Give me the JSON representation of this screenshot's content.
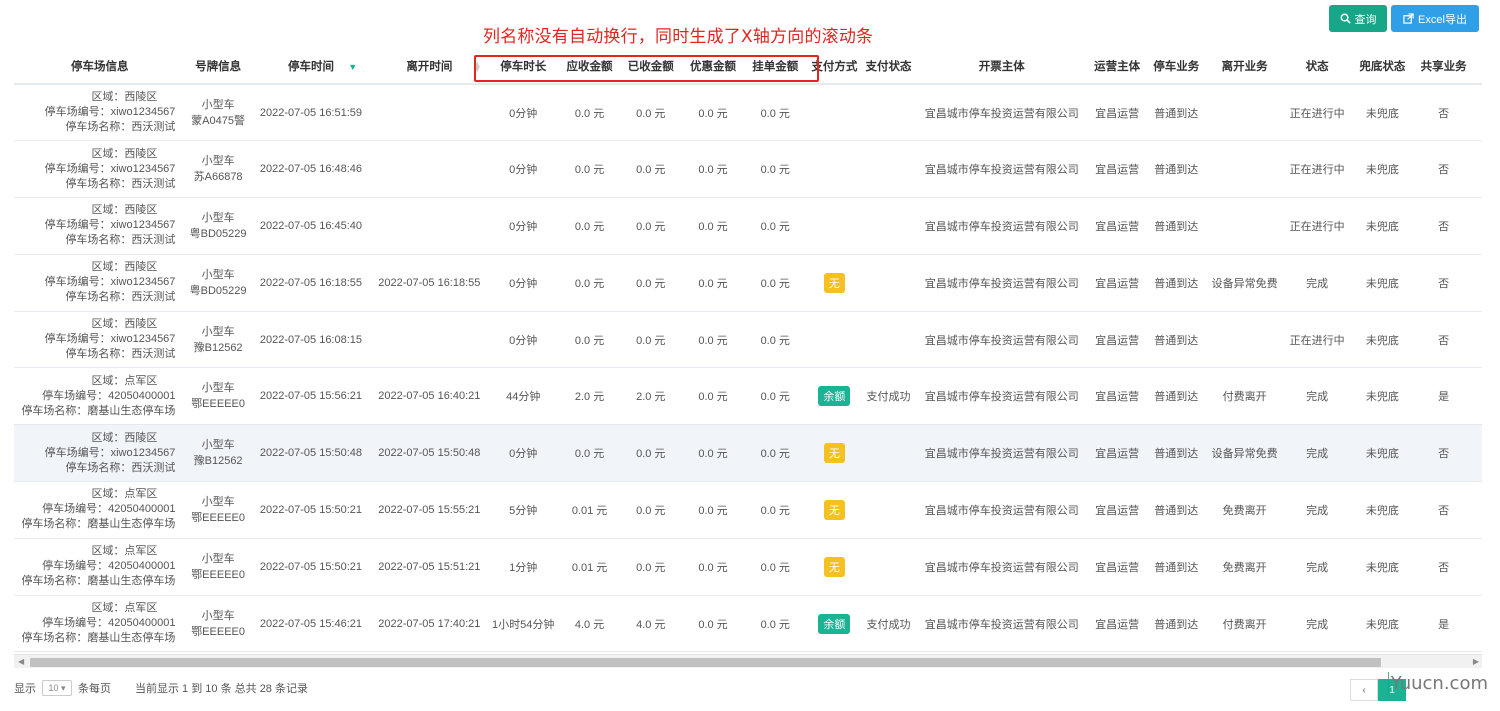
{
  "annotation": "列名称没有自动换行，同时生成了X轴方向的滚动条",
  "toolbar": {
    "query_label": "查询",
    "excel_label": "Excel导出"
  },
  "columns": [
    "停车场信息",
    "号牌信息",
    "停车时间",
    "离开时间",
    "停车时长",
    "应收金额",
    "已收金额",
    "优惠金额",
    "挂单金额",
    "支付方式",
    "支付状态",
    "开票主体",
    "运营主体",
    "停车业务",
    "离开业务",
    "状态",
    "兜底状态",
    "共享业务"
  ],
  "rows": [
    {
      "lot": [
        "区域：西陵区",
        "停车场编号：xiwo1234567",
        "停车场名称：西沃测试"
      ],
      "plate": [
        "小型车",
        "蒙A0475警"
      ],
      "park_time": "2022-07-05 16:51:59",
      "leave_time": "",
      "duration": "0分钟",
      "receivable": "0.0 元",
      "received": "0.0 元",
      "discount": "0.0 元",
      "pending": "0.0 元",
      "pay_method": "",
      "pay_status": "",
      "invoice": "宜昌城市停车投资运营有限公司",
      "operator": "宜昌运营",
      "business": "普通到达",
      "leave_business": "",
      "status": "正在进行中",
      "fallback": "未兜底",
      "shared": "否",
      "icon": "#bbbbbb"
    },
    {
      "lot": [
        "区域：西陵区",
        "停车场编号：xiwo1234567",
        "停车场名称：西沃测试"
      ],
      "plate": [
        "小型车",
        "苏A66878"
      ],
      "park_time": "2022-07-05 16:48:46",
      "leave_time": "",
      "duration": "0分钟",
      "receivable": "0.0 元",
      "received": "0.0 元",
      "discount": "0.0 元",
      "pending": "0.0 元",
      "pay_method": "",
      "pay_status": "",
      "invoice": "宜昌城市停车投资运营有限公司",
      "operator": "宜昌运营",
      "business": "普通到达",
      "leave_business": "",
      "status": "正在进行中",
      "fallback": "未兜底",
      "shared": "否",
      "icon": "#bbbbbb"
    },
    {
      "lot": [
        "区域：西陵区",
        "停车场编号：xiwo1234567",
        "停车场名称：西沃测试"
      ],
      "plate": [
        "小型车",
        "粤BD05229"
      ],
      "park_time": "2022-07-05 16:45:40",
      "leave_time": "",
      "duration": "0分钟",
      "receivable": "0.0 元",
      "received": "0.0 元",
      "discount": "0.0 元",
      "pending": "0.0 元",
      "pay_method": "",
      "pay_status": "",
      "invoice": "宜昌城市停车投资运营有限公司",
      "operator": "宜昌运营",
      "business": "普通到达",
      "leave_business": "",
      "status": "正在进行中",
      "fallback": "未兜底",
      "shared": "否",
      "icon": "#bbbbbb"
    },
    {
      "lot": [
        "区域：西陵区",
        "停车场编号：xiwo1234567",
        "停车场名称：西沃测试"
      ],
      "plate": [
        "小型车",
        "粤BD05229"
      ],
      "park_time": "2022-07-05 16:18:55",
      "leave_time": "2022-07-05 16:18:55",
      "duration": "0分钟",
      "receivable": "0.0 元",
      "received": "0.0 元",
      "discount": "0.0 元",
      "pending": "0.0 元",
      "pay_method": "无",
      "pay_method_color": "yellow",
      "pay_status": "",
      "invoice": "宜昌城市停车投资运营有限公司",
      "operator": "宜昌运营",
      "business": "普通到达",
      "leave_business": "设备异常免费",
      "status": "完成",
      "fallback": "未兜底",
      "shared": "否",
      "icon": "#bbbbbb"
    },
    {
      "lot": [
        "区域：西陵区",
        "停车场编号：xiwo1234567",
        "停车场名称：西沃测试"
      ],
      "plate": [
        "小型车",
        "豫B12562"
      ],
      "park_time": "2022-07-05 16:08:15",
      "leave_time": "",
      "duration": "0分钟",
      "receivable": "0.0 元",
      "received": "0.0 元",
      "discount": "0.0 元",
      "pending": "0.0 元",
      "pay_method": "",
      "pay_status": "",
      "invoice": "宜昌城市停车投资运营有限公司",
      "operator": "宜昌运营",
      "business": "普通到达",
      "leave_business": "",
      "status": "正在进行中",
      "fallback": "未兜底",
      "shared": "否",
      "icon": "#1ab394"
    },
    {
      "lot": [
        "区域：点军区",
        "停车场编号：42050400001",
        "停车场名称：磨基山生态停车场"
      ],
      "plate": [
        "小型车",
        "鄂EEEEE0"
      ],
      "park_time": "2022-07-05 15:56:21",
      "leave_time": "2022-07-05 16:40:21",
      "duration": "44分钟",
      "receivable": "2.0 元",
      "received": "2.0 元",
      "discount": "0.0 元",
      "pending": "0.0 元",
      "pay_method": "余额",
      "pay_method_color": "green",
      "pay_status": "支付成功",
      "invoice": "宜昌城市停车投资运营有限公司",
      "operator": "宜昌运营",
      "business": "普通到达",
      "leave_business": "付费离开",
      "status": "完成",
      "fallback": "未兜底",
      "shared": "是",
      "icon": "#1ab394"
    },
    {
      "lot": [
        "区域：西陵区",
        "停车场编号：xiwo1234567",
        "停车场名称：西沃测试"
      ],
      "plate": [
        "小型车",
        "豫B12562"
      ],
      "park_time": "2022-07-05 15:50:48",
      "leave_time": "2022-07-05 15:50:48",
      "duration": "0分钟",
      "receivable": "0.0 元",
      "received": "0.0 元",
      "discount": "0.0 元",
      "pending": "0.0 元",
      "pay_method": "无",
      "pay_method_color": "yellow",
      "pay_status": "",
      "invoice": "宜昌城市停车投资运营有限公司",
      "operator": "宜昌运营",
      "business": "普通到达",
      "leave_business": "设备异常免费",
      "status": "完成",
      "fallback": "未兜底",
      "shared": "否",
      "icon": "#1ab394",
      "highlight": true
    },
    {
      "lot": [
        "区域：点军区",
        "停车场编号：42050400001",
        "停车场名称：磨基山生态停车场"
      ],
      "plate": [
        "小型车",
        "鄂EEEEE0"
      ],
      "park_time": "2022-07-05 15:50:21",
      "leave_time": "2022-07-05 15:55:21",
      "duration": "5分钟",
      "receivable": "0.01 元",
      "received": "0.0 元",
      "discount": "0.0 元",
      "pending": "0.0 元",
      "pay_method": "无",
      "pay_method_color": "yellow",
      "pay_status": "",
      "invoice": "宜昌城市停车投资运营有限公司",
      "operator": "宜昌运营",
      "business": "普通到达",
      "leave_business": "免费离开",
      "status": "完成",
      "fallback": "未兜底",
      "shared": "否",
      "icon": "#1ab394"
    },
    {
      "lot": [
        "区域：点军区",
        "停车场编号：42050400001",
        "停车场名称：磨基山生态停车场"
      ],
      "plate": [
        "小型车",
        "鄂EEEEE0"
      ],
      "park_time": "2022-07-05 15:50:21",
      "leave_time": "2022-07-05 15:51:21",
      "duration": "1分钟",
      "receivable": "0.01 元",
      "received": "0.0 元",
      "discount": "0.0 元",
      "pending": "0.0 元",
      "pay_method": "无",
      "pay_method_color": "yellow",
      "pay_status": "",
      "invoice": "宜昌城市停车投资运营有限公司",
      "operator": "宜昌运营",
      "business": "普通到达",
      "leave_business": "免费离开",
      "status": "完成",
      "fallback": "未兜底",
      "shared": "否",
      "icon": "#1ab394"
    },
    {
      "lot": [
        "区域：点军区",
        "停车场编号：42050400001",
        "停车场名称：磨基山生态停车场"
      ],
      "plate": [
        "小型车",
        "鄂EEEEE0"
      ],
      "park_time": "2022-07-05 15:46:21",
      "leave_time": "2022-07-05 17:40:21",
      "duration": "1小时54分钟",
      "receivable": "4.0 元",
      "received": "4.0 元",
      "discount": "0.0 元",
      "pending": "0.0 元",
      "pay_method": "余额",
      "pay_method_color": "green",
      "pay_status": "支付成功",
      "invoice": "宜昌城市停车投资运营有限公司",
      "operator": "宜昌运营",
      "business": "普通到达",
      "leave_business": "付费离开",
      "status": "完成",
      "fallback": "未兜底",
      "shared": "是",
      "icon": "#1ab394"
    }
  ],
  "pager": {
    "show_label": "显示",
    "page_size": "10",
    "per_page_label": "条每页",
    "summary": "当前显示 1 到 10 条 总共 28 条记录",
    "prev": "‹",
    "current": "1"
  },
  "watermark": "Yuucn.com",
  "colors": {
    "accent": "#1ab394",
    "excel": "#2f9fe8",
    "annotation": "#e0261e",
    "badge_yellow": "#f5c121"
  }
}
